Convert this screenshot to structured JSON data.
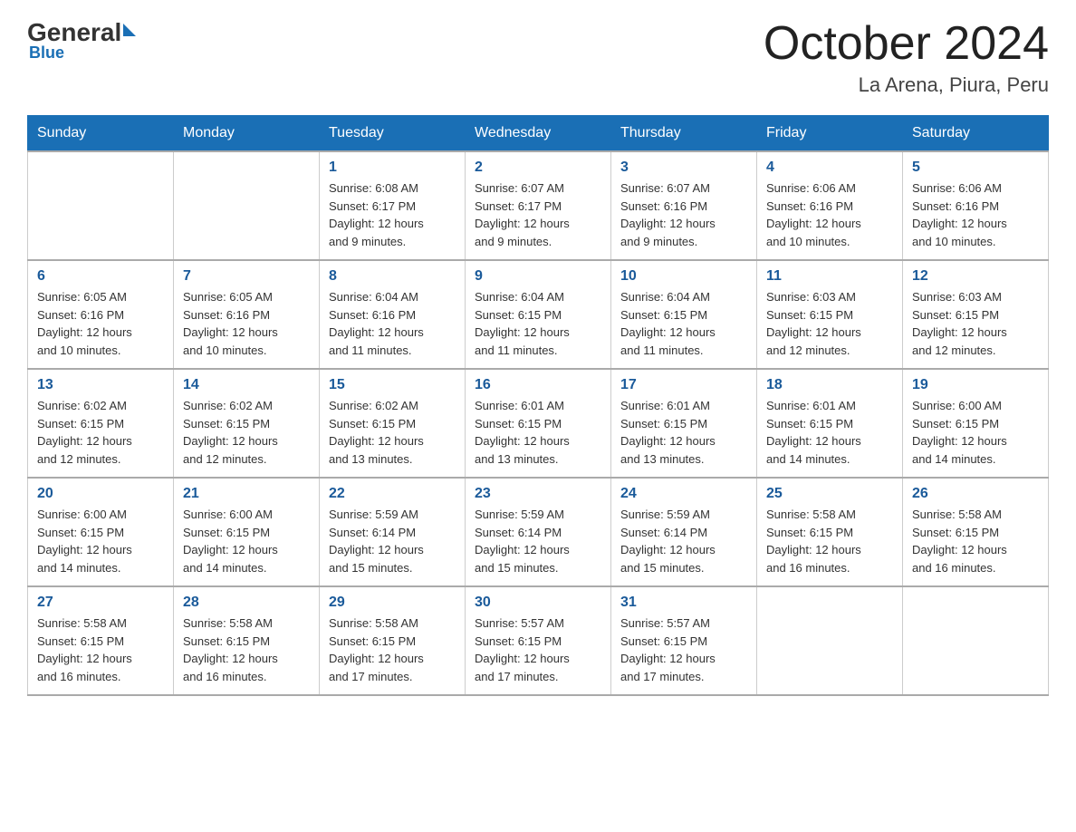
{
  "header": {
    "logo_general": "General",
    "logo_blue": "Blue",
    "month_title": "October 2024",
    "location": "La Arena, Piura, Peru"
  },
  "weekdays": [
    "Sunday",
    "Monday",
    "Tuesday",
    "Wednesday",
    "Thursday",
    "Friday",
    "Saturday"
  ],
  "weeks": [
    [
      {
        "day": "",
        "info": ""
      },
      {
        "day": "",
        "info": ""
      },
      {
        "day": "1",
        "sunrise": "6:08 AM",
        "sunset": "6:17 PM",
        "daylight": "12 hours and 9 minutes."
      },
      {
        "day": "2",
        "sunrise": "6:07 AM",
        "sunset": "6:17 PM",
        "daylight": "12 hours and 9 minutes."
      },
      {
        "day": "3",
        "sunrise": "6:07 AM",
        "sunset": "6:16 PM",
        "daylight": "12 hours and 9 minutes."
      },
      {
        "day": "4",
        "sunrise": "6:06 AM",
        "sunset": "6:16 PM",
        "daylight": "12 hours and 10 minutes."
      },
      {
        "day": "5",
        "sunrise": "6:06 AM",
        "sunset": "6:16 PM",
        "daylight": "12 hours and 10 minutes."
      }
    ],
    [
      {
        "day": "6",
        "sunrise": "6:05 AM",
        "sunset": "6:16 PM",
        "daylight": "12 hours and 10 minutes."
      },
      {
        "day": "7",
        "sunrise": "6:05 AM",
        "sunset": "6:16 PM",
        "daylight": "12 hours and 10 minutes."
      },
      {
        "day": "8",
        "sunrise": "6:04 AM",
        "sunset": "6:16 PM",
        "daylight": "12 hours and 11 minutes."
      },
      {
        "day": "9",
        "sunrise": "6:04 AM",
        "sunset": "6:15 PM",
        "daylight": "12 hours and 11 minutes."
      },
      {
        "day": "10",
        "sunrise": "6:04 AM",
        "sunset": "6:15 PM",
        "daylight": "12 hours and 11 minutes."
      },
      {
        "day": "11",
        "sunrise": "6:03 AM",
        "sunset": "6:15 PM",
        "daylight": "12 hours and 12 minutes."
      },
      {
        "day": "12",
        "sunrise": "6:03 AM",
        "sunset": "6:15 PM",
        "daylight": "12 hours and 12 minutes."
      }
    ],
    [
      {
        "day": "13",
        "sunrise": "6:02 AM",
        "sunset": "6:15 PM",
        "daylight": "12 hours and 12 minutes."
      },
      {
        "day": "14",
        "sunrise": "6:02 AM",
        "sunset": "6:15 PM",
        "daylight": "12 hours and 12 minutes."
      },
      {
        "day": "15",
        "sunrise": "6:02 AM",
        "sunset": "6:15 PM",
        "daylight": "12 hours and 13 minutes."
      },
      {
        "day": "16",
        "sunrise": "6:01 AM",
        "sunset": "6:15 PM",
        "daylight": "12 hours and 13 minutes."
      },
      {
        "day": "17",
        "sunrise": "6:01 AM",
        "sunset": "6:15 PM",
        "daylight": "12 hours and 13 minutes."
      },
      {
        "day": "18",
        "sunrise": "6:01 AM",
        "sunset": "6:15 PM",
        "daylight": "12 hours and 14 minutes."
      },
      {
        "day": "19",
        "sunrise": "6:00 AM",
        "sunset": "6:15 PM",
        "daylight": "12 hours and 14 minutes."
      }
    ],
    [
      {
        "day": "20",
        "sunrise": "6:00 AM",
        "sunset": "6:15 PM",
        "daylight": "12 hours and 14 minutes."
      },
      {
        "day": "21",
        "sunrise": "6:00 AM",
        "sunset": "6:15 PM",
        "daylight": "12 hours and 14 minutes."
      },
      {
        "day": "22",
        "sunrise": "5:59 AM",
        "sunset": "6:14 PM",
        "daylight": "12 hours and 15 minutes."
      },
      {
        "day": "23",
        "sunrise": "5:59 AM",
        "sunset": "6:14 PM",
        "daylight": "12 hours and 15 minutes."
      },
      {
        "day": "24",
        "sunrise": "5:59 AM",
        "sunset": "6:14 PM",
        "daylight": "12 hours and 15 minutes."
      },
      {
        "day": "25",
        "sunrise": "5:58 AM",
        "sunset": "6:15 PM",
        "daylight": "12 hours and 16 minutes."
      },
      {
        "day": "26",
        "sunrise": "5:58 AM",
        "sunset": "6:15 PM",
        "daylight": "12 hours and 16 minutes."
      }
    ],
    [
      {
        "day": "27",
        "sunrise": "5:58 AM",
        "sunset": "6:15 PM",
        "daylight": "12 hours and 16 minutes."
      },
      {
        "day": "28",
        "sunrise": "5:58 AM",
        "sunset": "6:15 PM",
        "daylight": "12 hours and 16 minutes."
      },
      {
        "day": "29",
        "sunrise": "5:58 AM",
        "sunset": "6:15 PM",
        "daylight": "12 hours and 17 minutes."
      },
      {
        "day": "30",
        "sunrise": "5:57 AM",
        "sunset": "6:15 PM",
        "daylight": "12 hours and 17 minutes."
      },
      {
        "day": "31",
        "sunrise": "5:57 AM",
        "sunset": "6:15 PM",
        "daylight": "12 hours and 17 minutes."
      },
      {
        "day": "",
        "info": ""
      },
      {
        "day": "",
        "info": ""
      }
    ]
  ],
  "labels": {
    "sunrise": "Sunrise: ",
    "sunset": "Sunset: ",
    "daylight": "Daylight: "
  }
}
